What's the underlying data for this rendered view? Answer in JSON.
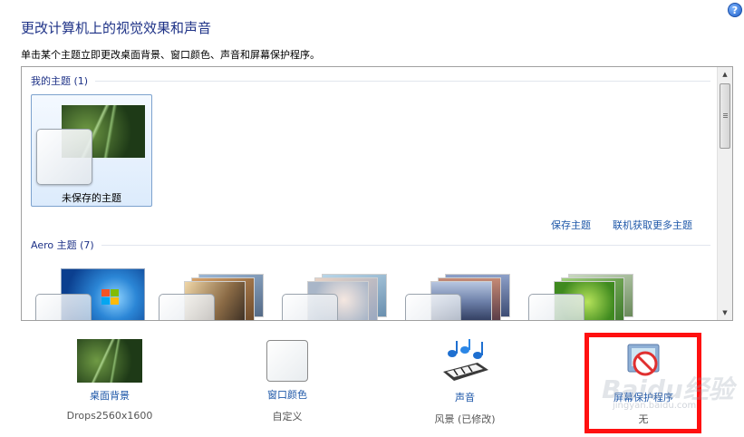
{
  "page": {
    "title": "更改计算机上的视觉效果和声音",
    "subtitle": "单击某个主题立即更改桌面背景、窗口颜色、声音和屏幕保护程序。",
    "help_symbol": "?"
  },
  "theme_panel": {
    "my_themes": {
      "header": "我的主题 (1)",
      "items": [
        {
          "label": "未保存的主题"
        }
      ]
    },
    "links": {
      "save_theme": "保存主题",
      "get_more_online": "联机获取更多主题"
    },
    "aero_themes": {
      "header": "Aero 主题 (7)"
    },
    "scrollbar": {
      "up_arrow": "▲",
      "down_arrow": "▼"
    }
  },
  "settings": [
    {
      "label": "桌面背景",
      "value": "Drops2560x1600",
      "icon": "desktop-background-thumbnail"
    },
    {
      "label": "窗口颜色",
      "value": "自定义",
      "icon": "window-color-swatch-icon"
    },
    {
      "label": "声音",
      "value": "风景 (已修改)",
      "icon": "sound-notes-icon"
    },
    {
      "label": "屏幕保护程序",
      "value": "无",
      "icon": "screensaver-no-icon"
    }
  ],
  "watermark": {
    "brand": "Baidu经验",
    "url": "jingyan.baidu.com"
  },
  "colors": {
    "title_blue": "#1e3287",
    "link_blue": "#1e57a8",
    "highlight_red": "#ff1010",
    "selected_tile_border": "#7da2ce"
  }
}
